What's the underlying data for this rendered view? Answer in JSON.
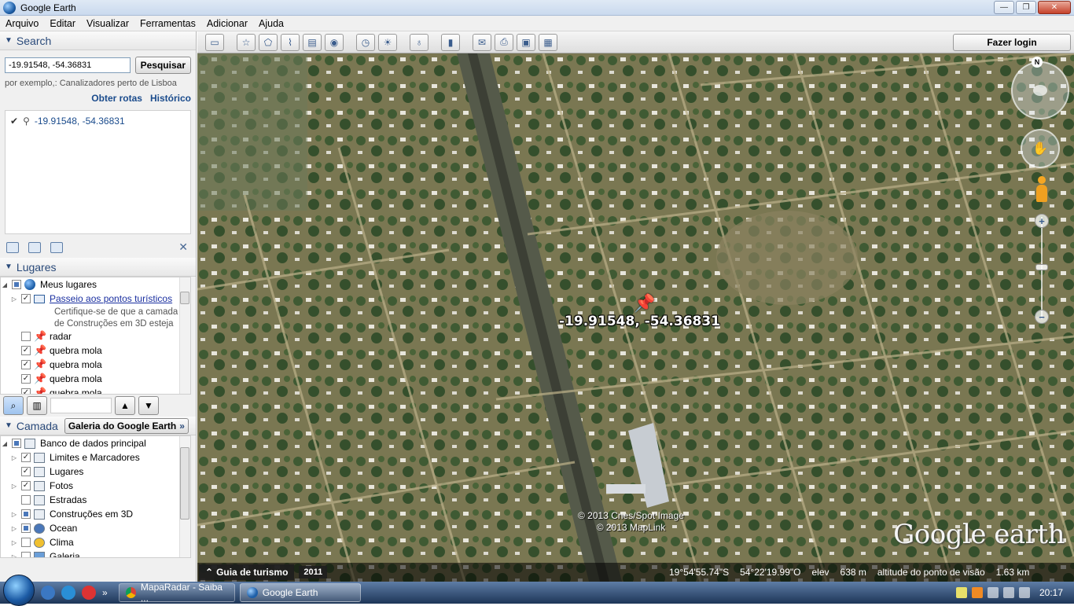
{
  "window": {
    "title": "Google Earth"
  },
  "menu": [
    "Arquivo",
    "Editar",
    "Visualizar",
    "Ferramentas",
    "Adicionar",
    "Ajuda"
  ],
  "search": {
    "header": "Search",
    "query": "-19.91548, -54.36831",
    "button": "Pesquisar",
    "hint": "por exemplo,: Canalizadores perto de Lisboa",
    "link_directions": "Obter rotas",
    "link_history": "Histórico",
    "result": "-19.91548, -54.36831"
  },
  "places": {
    "header": "Lugares",
    "my_places": "Meus lugares",
    "tour": "Passeio aos pontos turísticos",
    "tour_desc_1": "Certifique-se de que a camada",
    "tour_desc_2": "de Construções em 3D esteja",
    "items": [
      "radar",
      "quebra mola",
      "quebra mola",
      "quebra mola",
      "quebra mola"
    ]
  },
  "layers": {
    "header": "Camada",
    "gallery_button": "Galeria do Google Earth",
    "root": "Banco de dados principal",
    "items": [
      "Limites e Marcadores",
      "Lugares",
      "Fotos",
      "Estradas",
      "Construções em 3D",
      "Ocean",
      "Clima",
      "Galeria"
    ]
  },
  "toolbar": {
    "login": "Fazer login"
  },
  "map": {
    "placemark_label": "-19.91548, -54.36831",
    "copyright_1": "© 2013 Cnes/Spot Image",
    "copyright_2": "© 2013 MapLink",
    "brand": "Google earth",
    "compass_n": "N"
  },
  "status": {
    "tour_button": "Guia de turismo",
    "year": "2011",
    "lat": "19°54'55.74\"S",
    "lon": "54°22'19.99\"O",
    "elev_label": "elev",
    "elev_value": "638 m",
    "alt_label": "altitude do ponto de visão",
    "alt_value": "1.63 km"
  },
  "taskbar": {
    "task1": "MapaRadar - Saiba ...",
    "task2": "Google Earth",
    "clock": "20:17"
  }
}
